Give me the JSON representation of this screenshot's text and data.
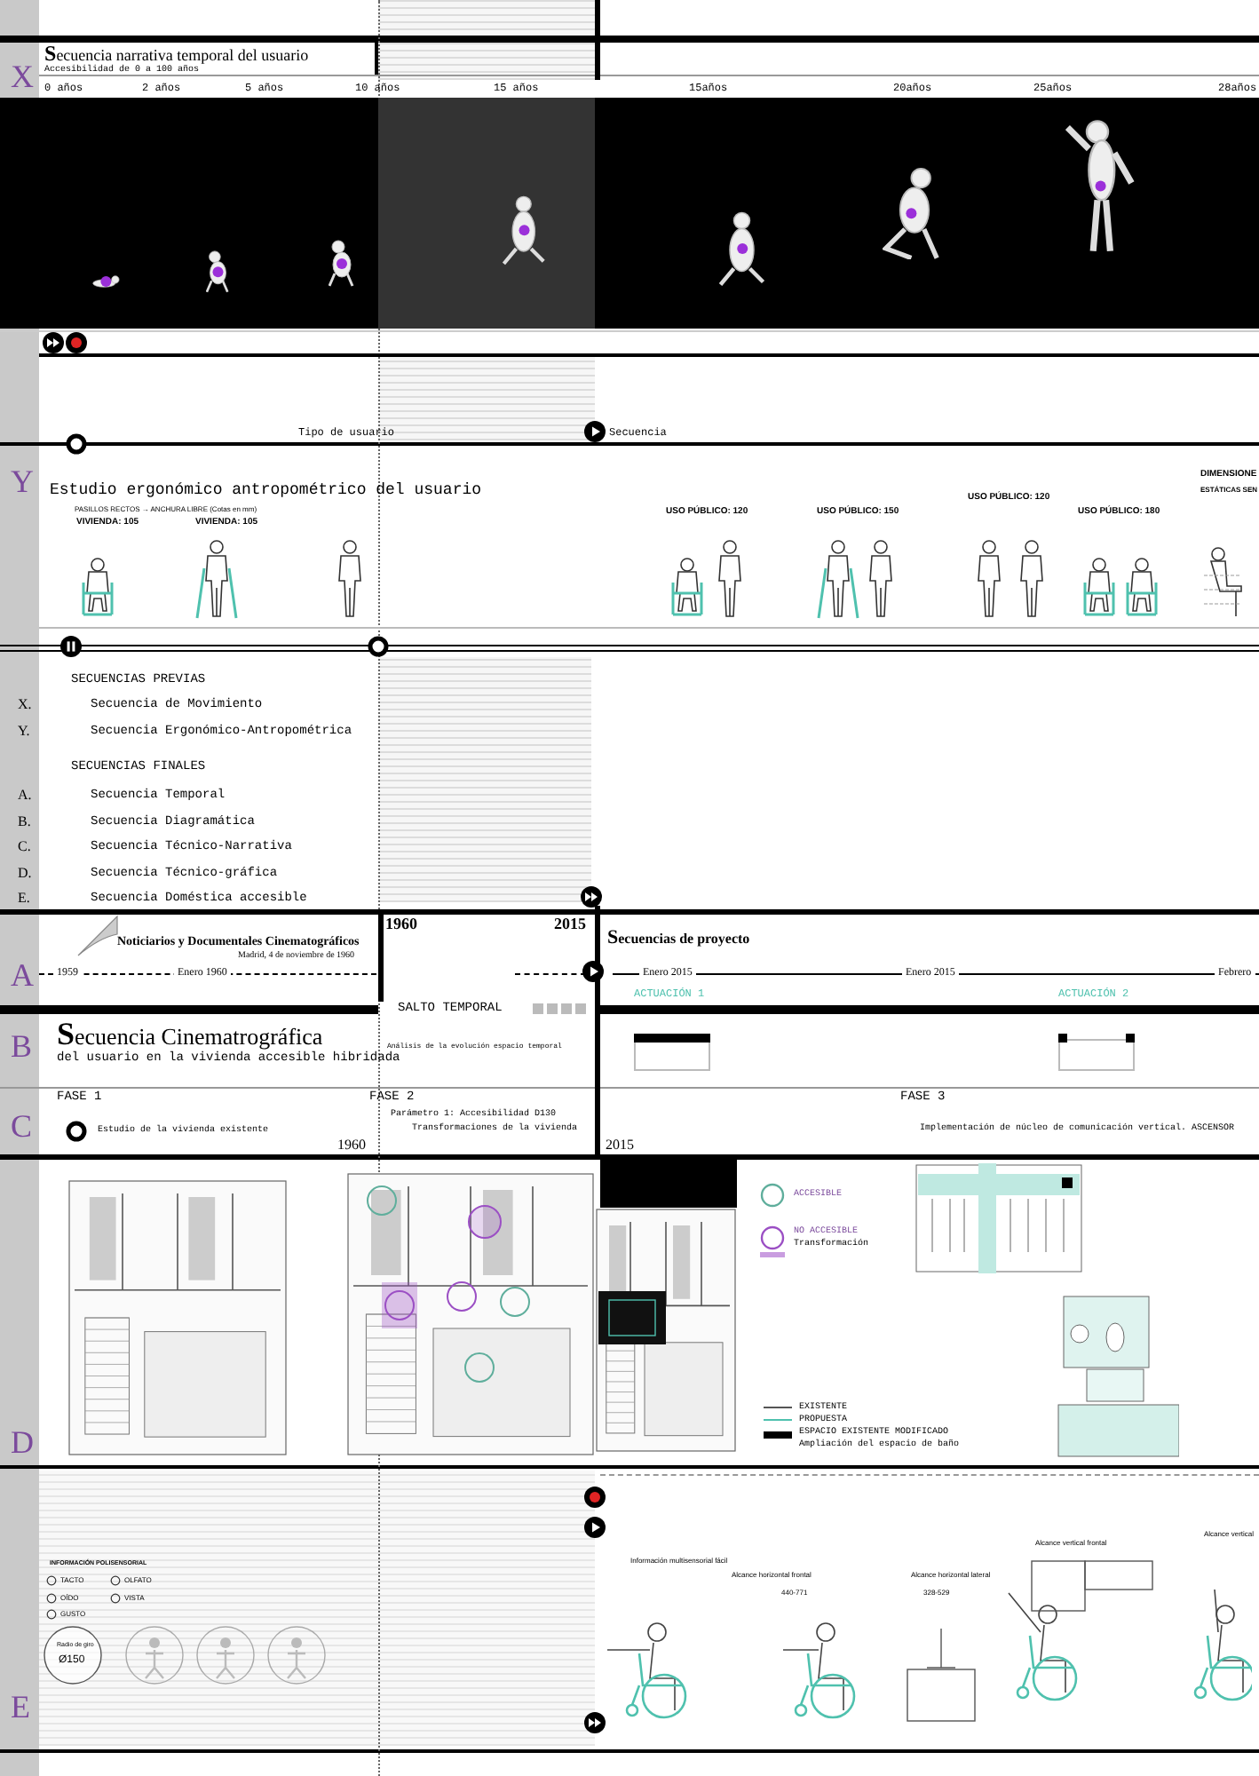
{
  "header": {
    "letter": "X",
    "title": "Secuencia narrativa temporal del usuario",
    "subtitle": "Accesibilidad de 0 a 100 años",
    "ages": [
      "0 años",
      "2 años",
      "5 años",
      "10 años",
      "15 años",
      "15años",
      "20años",
      "25años",
      "28años"
    ]
  },
  "markers": [
    {
      "kind": "skip"
    },
    {
      "kind": "record"
    },
    {
      "kind": "ring"
    },
    {
      "kind": "play"
    },
    {
      "kind": "pause"
    },
    {
      "kind": "ring"
    },
    {
      "kind": "skip"
    },
    {
      "kind": "play"
    },
    {
      "kind": "ring"
    },
    {
      "kind": "record"
    },
    {
      "kind": "play"
    },
    {
      "kind": "skip"
    }
  ],
  "sequence_labels": {
    "user_type": "Tipo de usuario",
    "sequence": "Secuencia"
  },
  "ergonomics": {
    "letter": "Y",
    "title": "Estudio ergonómico antropométrico del usuario",
    "note": "PASILLOS RECTOS → ANCHURA LIBRE (Cotas en mm)",
    "groups": [
      {
        "label": "VIVIENDA: 105",
        "figures": [
          {
            "kind": "wheelchair"
          }
        ]
      },
      {
        "label": "VIVIENDA: 105",
        "figures": [
          {
            "kind": "crutches"
          }
        ]
      },
      {
        "figures": [
          {
            "kind": "standing"
          }
        ]
      },
      {
        "label": "USO PÚBLICO: 120",
        "figures": [
          {
            "kind": "wheelchair"
          },
          {
            "kind": "standing"
          }
        ]
      },
      {
        "label": "USO PÚBLICO: 150",
        "figures": [
          {
            "kind": "crutches"
          },
          {
            "kind": "standing"
          }
        ]
      },
      {
        "label": "USO PÚBLICO: 120",
        "figures": [
          {
            "kind": "standing"
          },
          {
            "kind": "standing"
          }
        ]
      },
      {
        "label": "USO PÚBLICO: 180",
        "figures": [
          {
            "kind": "wheelchair"
          },
          {
            "kind": "wheelchair"
          }
        ]
      },
      {
        "label": "DIMENSIONE",
        "sublabel": "ESTÁTICAS SEN",
        "figures": [
          {
            "kind": "seated"
          }
        ]
      }
    ]
  },
  "index": {
    "previas_heading": "SECUENCIAS PREVIAS",
    "previas": [
      {
        "letter": "X.",
        "label": "Secuencia de Movimiento"
      },
      {
        "letter": "Y.",
        "label": "Secuencia Ergonómico-Antropométrica"
      }
    ],
    "finales_heading": "SECUENCIAS FINALES",
    "finales": [
      {
        "letter": "A.",
        "label": "Secuencia Temporal"
      },
      {
        "letter": "B.",
        "label": "Secuencia Diagramática"
      },
      {
        "letter": "C.",
        "label": "Secuencia Técnico-Narrativa"
      },
      {
        "letter": "D.",
        "label": "Secuencia Técnico-gráfica"
      },
      {
        "letter": "E.",
        "label": "Secuencia Doméstica accesible"
      }
    ]
  },
  "years": [
    "1960",
    "2015"
  ],
  "section_a": {
    "letter": "A",
    "newsreel_title": "Noticiarios y Documentales Cinematográficos",
    "newsreel_date": "Madrid, 4 de noviembre de 1960",
    "timeline": [
      "1959",
      "Enero 1960",
      "Enero 2015",
      "Enero 2015",
      "Febrero"
    ],
    "project_title": "Secuencias de proyecto",
    "actuaciones": [
      "ACTUACIÓN 1",
      "ACTUACIÓN 2"
    ]
  },
  "time_jump": "SALTO TEMPORAL",
  "section_b": {
    "letter": "B",
    "title": "Secuencia Cinematrográfica",
    "subtitle": "del usuario en la vivienda accesible hibridada",
    "analysis": "Análisis de la evolución espacio temporal"
  },
  "section_c": {
    "letter": "C",
    "phases": [
      {
        "label": "FASE 1",
        "notes": [
          "Estudio de la vivienda existente"
        ]
      },
      {
        "label": "FASE 2",
        "notes": [
          "Parámetro 1: Accesibilidad D130",
          "Transformaciones de la vivienda"
        ]
      },
      {
        "label": "FASE 3",
        "notes": [
          "Implementación de núcleo de comunicación vertical. ASCENSOR"
        ]
      }
    ],
    "years": [
      "1960",
      "2015"
    ]
  },
  "section_d": {
    "letter": "D",
    "circle_legend": [
      {
        "label": "ACCESIBLE",
        "color": "#5fae9c"
      },
      {
        "label": "NO ACCESIBLE",
        "color": "#9b4fc4"
      }
    ],
    "transformation": "Transformación",
    "line_legend": [
      {
        "label": "EXISTENTE",
        "color": "#555555"
      },
      {
        "label": "PROPUESTA",
        "color": "#4fc1ae"
      },
      {
        "label": "ESPACIO EXISTENTE MODIFICADO",
        "color": "#000000"
      }
    ],
    "note": "Ampliación del espacio de baño"
  },
  "section_e": {
    "letter": "E",
    "senses_heading": "INFORMACIÓN POLISENSORIAL",
    "senses": [
      "TACTO",
      "OLFATO",
      "OÍDO",
      "VISTA",
      "GUSTO"
    ],
    "turning_label": "Radio de giro",
    "turning_value": "Ø150",
    "reach": [
      {
        "title": "Información multisensorial fácil"
      },
      {
        "title": "Alcance horizontal frontal",
        "value": "440-771"
      },
      {
        "title": "Alcance horizontal lateral",
        "value": "328-529"
      },
      {
        "title": "Alcance vertical frontal"
      },
      {
        "title": "Alcance vertical"
      }
    ]
  }
}
